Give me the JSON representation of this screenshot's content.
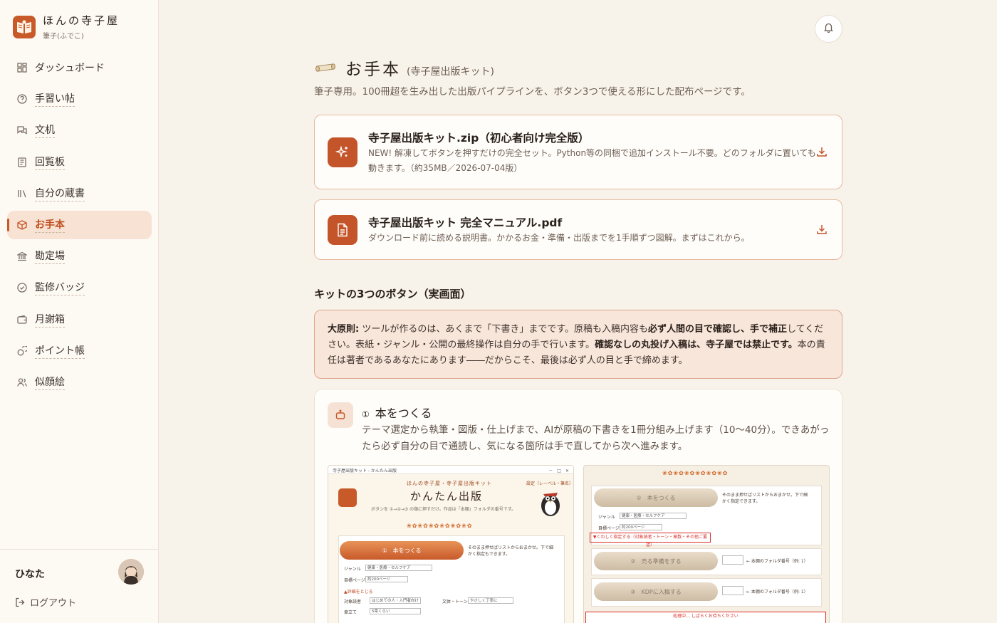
{
  "brand": {
    "title": "ほんの寺子屋",
    "subtitle": "筆子(ふでこ)"
  },
  "nav": [
    {
      "label": "ダッシュボード",
      "icon": "dashboard-icon",
      "active": false
    },
    {
      "label": "手習い帖",
      "icon": "help-circle-icon",
      "active": false
    },
    {
      "label": "文机",
      "icon": "chat-icon",
      "active": false
    },
    {
      "label": "回覧板",
      "icon": "board-icon",
      "active": false
    },
    {
      "label": "自分の蔵書",
      "icon": "library-icon",
      "active": false
    },
    {
      "label": "お手本",
      "icon": "box-icon",
      "active": true
    },
    {
      "label": "勘定場",
      "icon": "bank-icon",
      "active": false
    },
    {
      "label": "監修バッジ",
      "icon": "badge-check-icon",
      "active": false
    },
    {
      "label": "月謝箱",
      "icon": "wallet-icon",
      "active": false
    },
    {
      "label": "ポイント帳",
      "icon": "coins-icon",
      "active": false
    },
    {
      "label": "似顔絵",
      "icon": "users-icon",
      "active": false
    }
  ],
  "user": {
    "name": "ひなた",
    "logout": "ログアウト"
  },
  "header": {
    "title": "お手本",
    "subtitle": "(寺子屋出版キット)",
    "description": "筆子専用。100冊超を生み出した出版パイプラインを、ボタン3つで使える形にした配布ページです。"
  },
  "downloads": [
    {
      "title": "寺子屋出版キット.zip（初心者向け完全版）",
      "desc": "NEW! 解凍してボタンを押すだけの完全セット。Python等の同梱で追加インストール不要。どのフォルダに置いても動きます。（約35MB／2026-07-04版）",
      "icon": "sparkle-icon"
    },
    {
      "title": "寺子屋出版キット 完全マニュアル.pdf",
      "desc": "ダウンロード前に読める説明書。かかるお金・準備・出版までを1手順ずつ図解。まずはこれから。",
      "icon": "document-icon"
    }
  ],
  "section_title": "キットの3つのボタン（実画面）",
  "principle": {
    "label": "大原則:",
    "t1": " ツールが作るのは、あくまで「下書き」までです。原稿も入稿内容も",
    "b1": "必ず人間の目で確認し、手で補正",
    "t2": "してください。表紙・ジャンル・公開の最終操作は自分の手で行います。",
    "b2": "確認なしの丸投げ入稿は、寺子屋では禁止です。",
    "t3": "本の責任は著者であるあなたにあります――だからこそ、最後は必ず人の目と手で締めます。"
  },
  "step": {
    "num": "①",
    "title": "本をつくる",
    "desc": "テーマ選定から執筆・図版・仕上げまで、AIが原稿の下書きを1冊分組み上げます（10〜40分）。できあがったら必ず自分の目で通読し、気になる箇所は手で直してから次へ進みます。"
  },
  "shot1": {
    "window_title": "寺子屋出版キット - かんたん出版",
    "brand": "ほんの寺子屋・寺子屋出版キット",
    "heading": "かんたん出版",
    "sub": "ボタンを ①→②→③ の順に押すだけ。作品は「本棚」フォルダの番号です。",
    "tag": "設定（レーベル・筆名）",
    "btn1": "①　本をつくる",
    "btn1_note": "そのまま押せばリストからおまかせ。下で細かく指定もできます。",
    "genre_label": "ジャンル",
    "genre_val": "健康・医療・セルフケア",
    "pages_label": "目標ページ",
    "pages_val": "約200ページ",
    "detail_toggle": "▲詳細をとじる",
    "reader_label": "対象読者",
    "reader_val": "はじめての人・入門者向け",
    "style_label": "文体・トーン",
    "style_val": "やさしく丁寧に",
    "chapters_label": "章立て",
    "chapters_val": "5章くらい"
  },
  "shot2": {
    "btn1": "①　本をつくる",
    "btn1_note": "そのまま押せばリストからおまかせ。下で細かく指定できます。",
    "genre_label": "ジャンル",
    "genre_val": "健康・医療・セルフケア",
    "pages_label": "目標ページ",
    "pages_val": "約200ページ",
    "detail_link": "▼くわしく指定する（対象読者・トーン・章数・その他ご要望）",
    "btn2": "②　売る準備をする",
    "btn2_note": "← 本棚のフォルダ番号（例: 1）",
    "btn3": "③　KDPに入稿する",
    "btn3_note": "← 本棚のフォルダ番号（例: 1）",
    "processing": "処理中... しばらくお待ちください"
  }
}
